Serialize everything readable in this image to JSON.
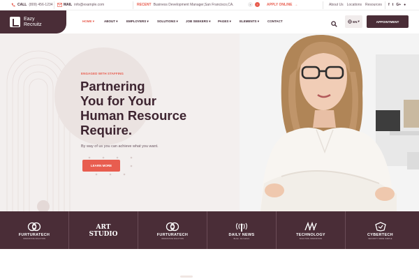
{
  "topbar": {
    "call_label": "CALL",
    "call_value": "(809) 456-1234",
    "mail_label": "MAIL",
    "mail_value": "info@example.com",
    "recent_label": "RECENT",
    "recent_text": "Business Development Manager,San Francisco,CA.",
    "apply_label": "APPLY ONLINE",
    "links": [
      "About Us",
      "Locations",
      "Resources"
    ],
    "social": [
      "f",
      "t",
      "G+",
      "●"
    ]
  },
  "nav": {
    "logo_line1": "Eazy",
    "logo_line2": "Recruitz",
    "items": [
      {
        "label": "HOME",
        "active": true
      },
      {
        "label": "ABOUT"
      },
      {
        "label": "EMPLOYERS"
      },
      {
        "label": "SOLUTIONS"
      },
      {
        "label": "JOB SEEKERS"
      },
      {
        "label": "PAGES"
      },
      {
        "label": "ELEMENTS"
      },
      {
        "label": "CONTACT"
      }
    ],
    "language": "EN",
    "appointment": "APPOINTMENT"
  },
  "hero": {
    "tag": "ENGAGED WITH STAFFING",
    "title_line1": "Partnering",
    "title_line2": "You for Your",
    "title_line3": "Human Resource",
    "title_line4": "Require.",
    "subtitle": "By way of us you can achieve what you want.",
    "cta": "LEARN MORE"
  },
  "partners": [
    {
      "name": "FURTURATECH",
      "sub": "INNOVATIVE SOLUTION",
      "icon": "rings-icon"
    },
    {
      "name": "ART STUDIO",
      "sub": "",
      "icon": "art-studio-logo"
    },
    {
      "name": "FURTURATECH",
      "sub": "INNOVATIVE SOLUTION",
      "icon": "rings-icon"
    },
    {
      "name": "DAILY NEWS",
      "sub": "Better Journalism",
      "icon": "broadcast-icon"
    },
    {
      "name": "TECHNOLOGY",
      "sub": "SOLUTION INNOVATION",
      "icon": "stripes-icon"
    },
    {
      "name": "CYBERTECH",
      "sub": "SECURITY MADE SIMPLE",
      "icon": "shield-icon"
    }
  ],
  "colors": {
    "brand": "#4a2d37",
    "accent": "#e85d4f",
    "hero_bg": "#f3efee"
  }
}
